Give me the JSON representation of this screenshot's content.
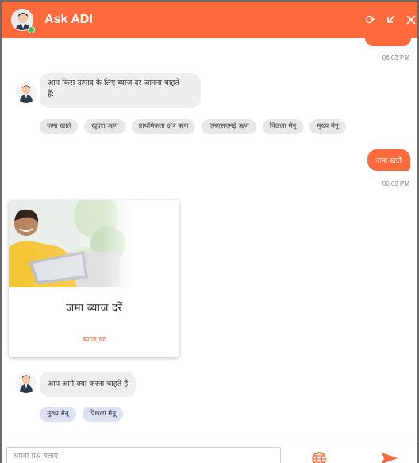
{
  "header": {
    "title": "Ask ADI",
    "refresh_icon": "refresh-icon",
    "minimize_icon": "minimize-icon",
    "close_icon": "close-icon",
    "accent_color": "#ff6a3d"
  },
  "messages": {
    "top_time": "06:03 PM",
    "bot1": {
      "text_line1": "आप किस उत्पाद के लिए ब्याज दर जानना चाहते",
      "text_line2": "हैं:"
    },
    "chips1": [
      "जमा खाते",
      "खुदरा ऋण",
      "प्राथमिकता क्षेत्र ऋण",
      "एमएसएमई ऋण",
      "पिछला मेनू",
      "मुख्य मेनू"
    ],
    "user1": {
      "text": "जमा खाते",
      "time": "06:03 PM"
    },
    "card": {
      "title": "जमा ब्याज दरें",
      "link": "ब्याज दर"
    },
    "bot2": {
      "text": "आप आगे क्या करना चाहते हैं"
    },
    "chips2": [
      "मुख्य मेनू",
      "पिछला मेनू"
    ]
  },
  "footer": {
    "placeholder": "अपना प्रश्न बताएं",
    "globe_icon": "globe-icon",
    "send_icon": "send-icon"
  }
}
